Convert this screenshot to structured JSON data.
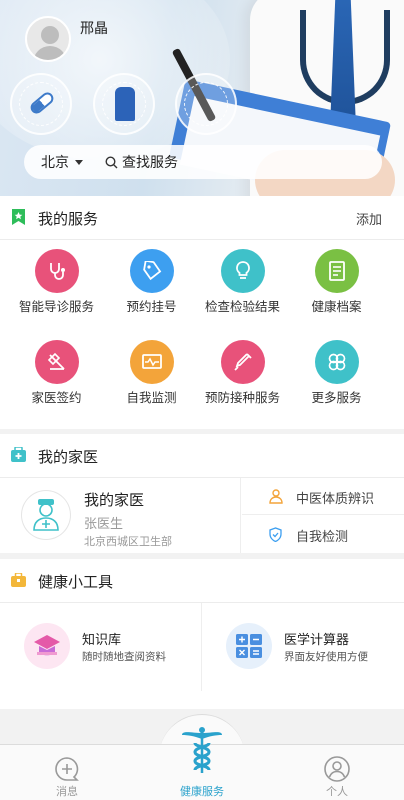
{
  "header": {
    "username": "邢晶",
    "city": "北京",
    "search_placeholder": "查找服务"
  },
  "my_services": {
    "title": "我的服务",
    "action": "添加",
    "items": [
      {
        "label": "智能导诊服务",
        "icon": "stethoscope-icon",
        "color": "#e8527a"
      },
      {
        "label": "预约挂号",
        "icon": "tag-icon",
        "color": "#3d9ff0"
      },
      {
        "label": "检查检验结果",
        "icon": "lightbulb-icon",
        "color": "#3fc1c9"
      },
      {
        "label": "健康档案",
        "icon": "document-icon",
        "color": "#7ac043"
      },
      {
        "label": "家医签约",
        "icon": "sign-icon",
        "color": "#e8527a"
      },
      {
        "label": "自我监测",
        "icon": "monitor-icon",
        "color": "#f3a43a"
      },
      {
        "label": "预防接种服务",
        "icon": "syringe-icon",
        "color": "#e8527a"
      },
      {
        "label": "更多服务",
        "icon": "clover-icon",
        "color": "#3fc1c9"
      }
    ]
  },
  "family_doctor": {
    "title": "我的家医",
    "card_title": "我的家医",
    "doctor_name": "张医生",
    "organization": "北京西城区卫生部",
    "links": [
      {
        "label": "中医体质辨识",
        "icon": "person-icon"
      },
      {
        "label": "自我检测",
        "icon": "shield-icon"
      }
    ]
  },
  "tools": {
    "title": "健康小工具",
    "items": [
      {
        "title": "知识库",
        "subtitle": "随时随地查阅资料",
        "icon": "graduation-cap-icon",
        "color": "#fde6f2"
      },
      {
        "title": "医学计算器",
        "subtitle": "界面友好使用方便",
        "icon": "calculator-icon",
        "color": "#e6f0fb"
      }
    ]
  },
  "tabbar": {
    "tabs": [
      {
        "label": "消息",
        "icon": "chat-plus-icon"
      },
      {
        "label": "健康服务",
        "icon": "caduceus-icon"
      },
      {
        "label": "个人",
        "icon": "user-icon"
      }
    ],
    "active_color": "#2aa2cc",
    "inactive_color": "#999999"
  }
}
